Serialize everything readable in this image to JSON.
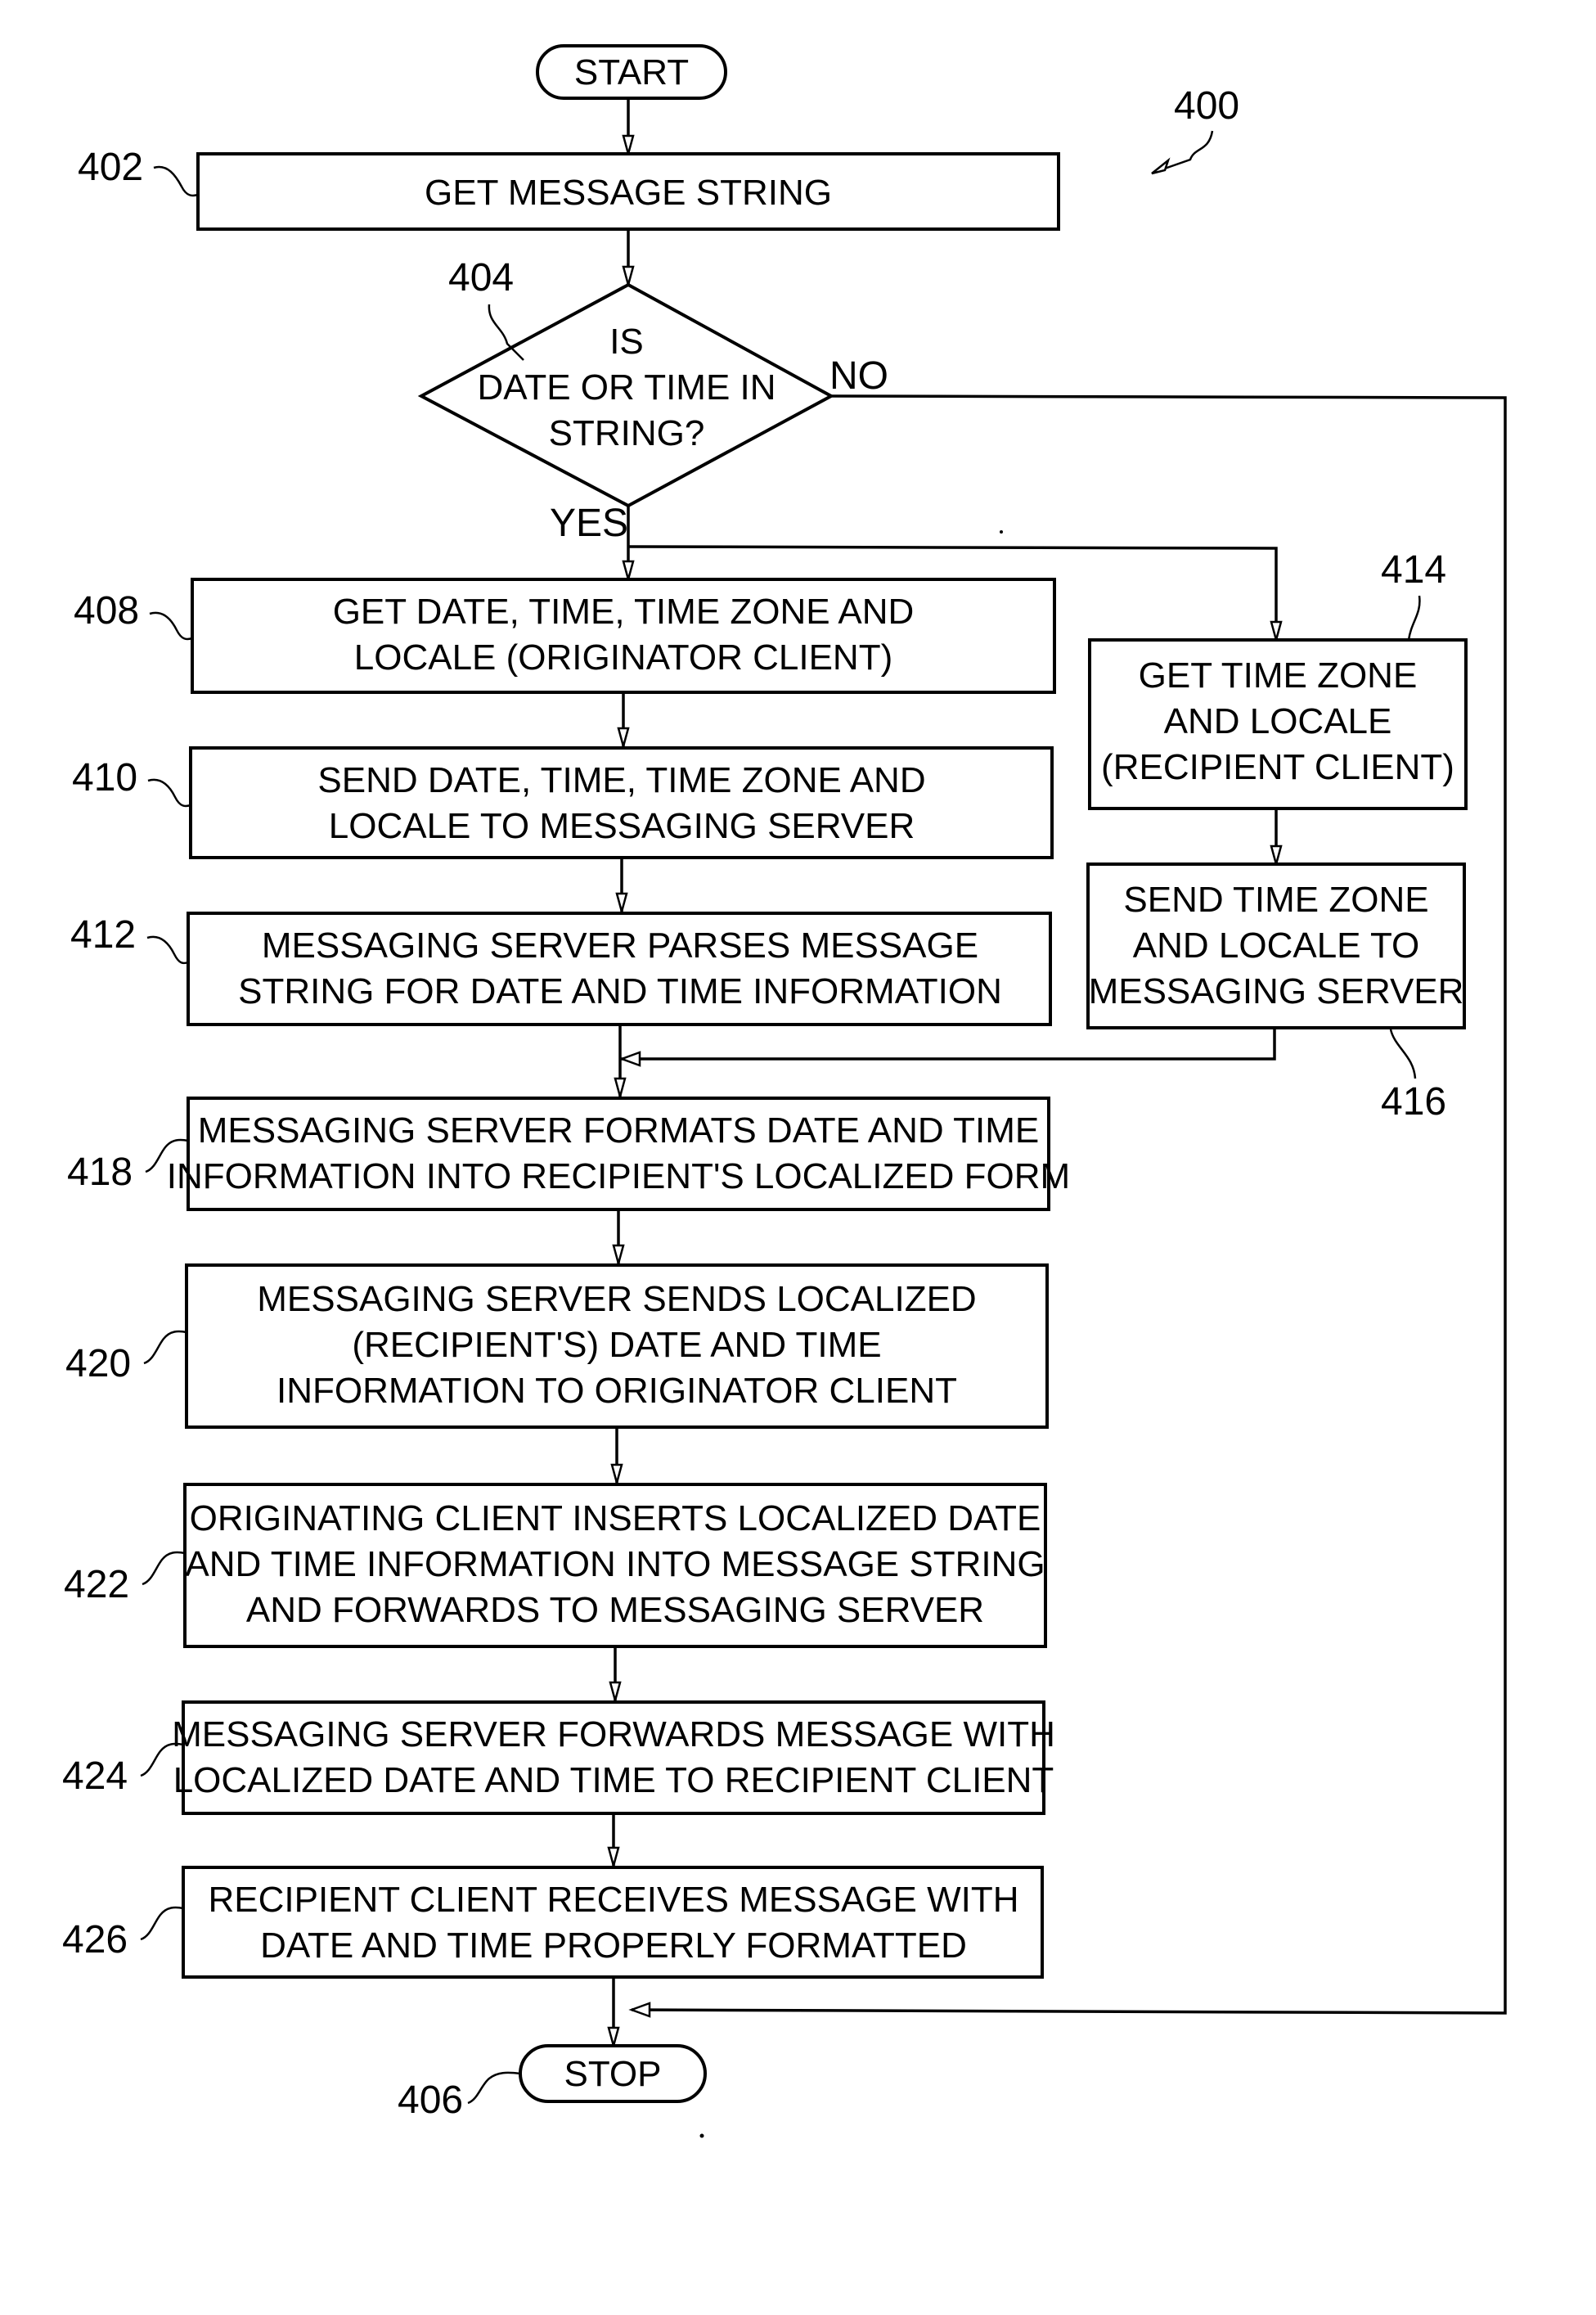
{
  "figure": {
    "ref": "400",
    "terminals": {
      "start": {
        "label": "START"
      },
      "stop": {
        "label": "STOP",
        "ref": "406"
      }
    },
    "decision": {
      "ref": "404",
      "lines": [
        "IS",
        "DATE OR TIME IN",
        "STRING?"
      ],
      "yes_label": "YES",
      "no_label": "NO"
    },
    "steps": {
      "s402": {
        "ref": "402",
        "lines": [
          "GET MESSAGE STRING"
        ]
      },
      "s408": {
        "ref": "408",
        "lines": [
          "GET DATE, TIME, TIME ZONE AND",
          "LOCALE (ORIGINATOR CLIENT)"
        ]
      },
      "s410": {
        "ref": "410",
        "lines": [
          "SEND DATE, TIME, TIME ZONE AND",
          "LOCALE TO MESSAGING SERVER"
        ]
      },
      "s412": {
        "ref": "412",
        "lines": [
          "MESSAGING SERVER PARSES MESSAGE",
          "STRING FOR DATE AND TIME INFORMATION"
        ]
      },
      "s414": {
        "ref": "414",
        "lines": [
          "GET TIME ZONE",
          "AND LOCALE",
          "(RECIPIENT CLIENT)"
        ]
      },
      "s416": {
        "ref": "416",
        "lines": [
          "SEND TIME ZONE",
          "AND LOCALE TO",
          "MESSAGING SERVER"
        ]
      },
      "s418": {
        "ref": "418",
        "lines": [
          "MESSAGING SERVER FORMATS DATE AND TIME",
          "INFORMATION INTO RECIPIENT'S LOCALIZED FORM"
        ]
      },
      "s420": {
        "ref": "420",
        "lines": [
          "MESSAGING SERVER SENDS LOCALIZED",
          "(RECIPIENT'S) DATE AND TIME",
          "INFORMATION TO ORIGINATOR CLIENT"
        ]
      },
      "s422": {
        "ref": "422",
        "lines": [
          "ORIGINATING CLIENT INSERTS LOCALIZED DATE",
          "AND TIME INFORMATION INTO MESSAGE STRING",
          "AND FORWARDS TO MESSAGING SERVER"
        ]
      },
      "s424": {
        "ref": "424",
        "lines": [
          "MESSAGING SERVER FORWARDS MESSAGE WITH",
          "LOCALIZED DATE AND TIME TO RECIPIENT CLIENT"
        ]
      },
      "s426": {
        "ref": "426",
        "lines": [
          "RECIPIENT CLIENT RECEIVES MESSAGE WITH",
          "DATE AND TIME PROPERLY FORMATTED"
        ]
      }
    }
  }
}
